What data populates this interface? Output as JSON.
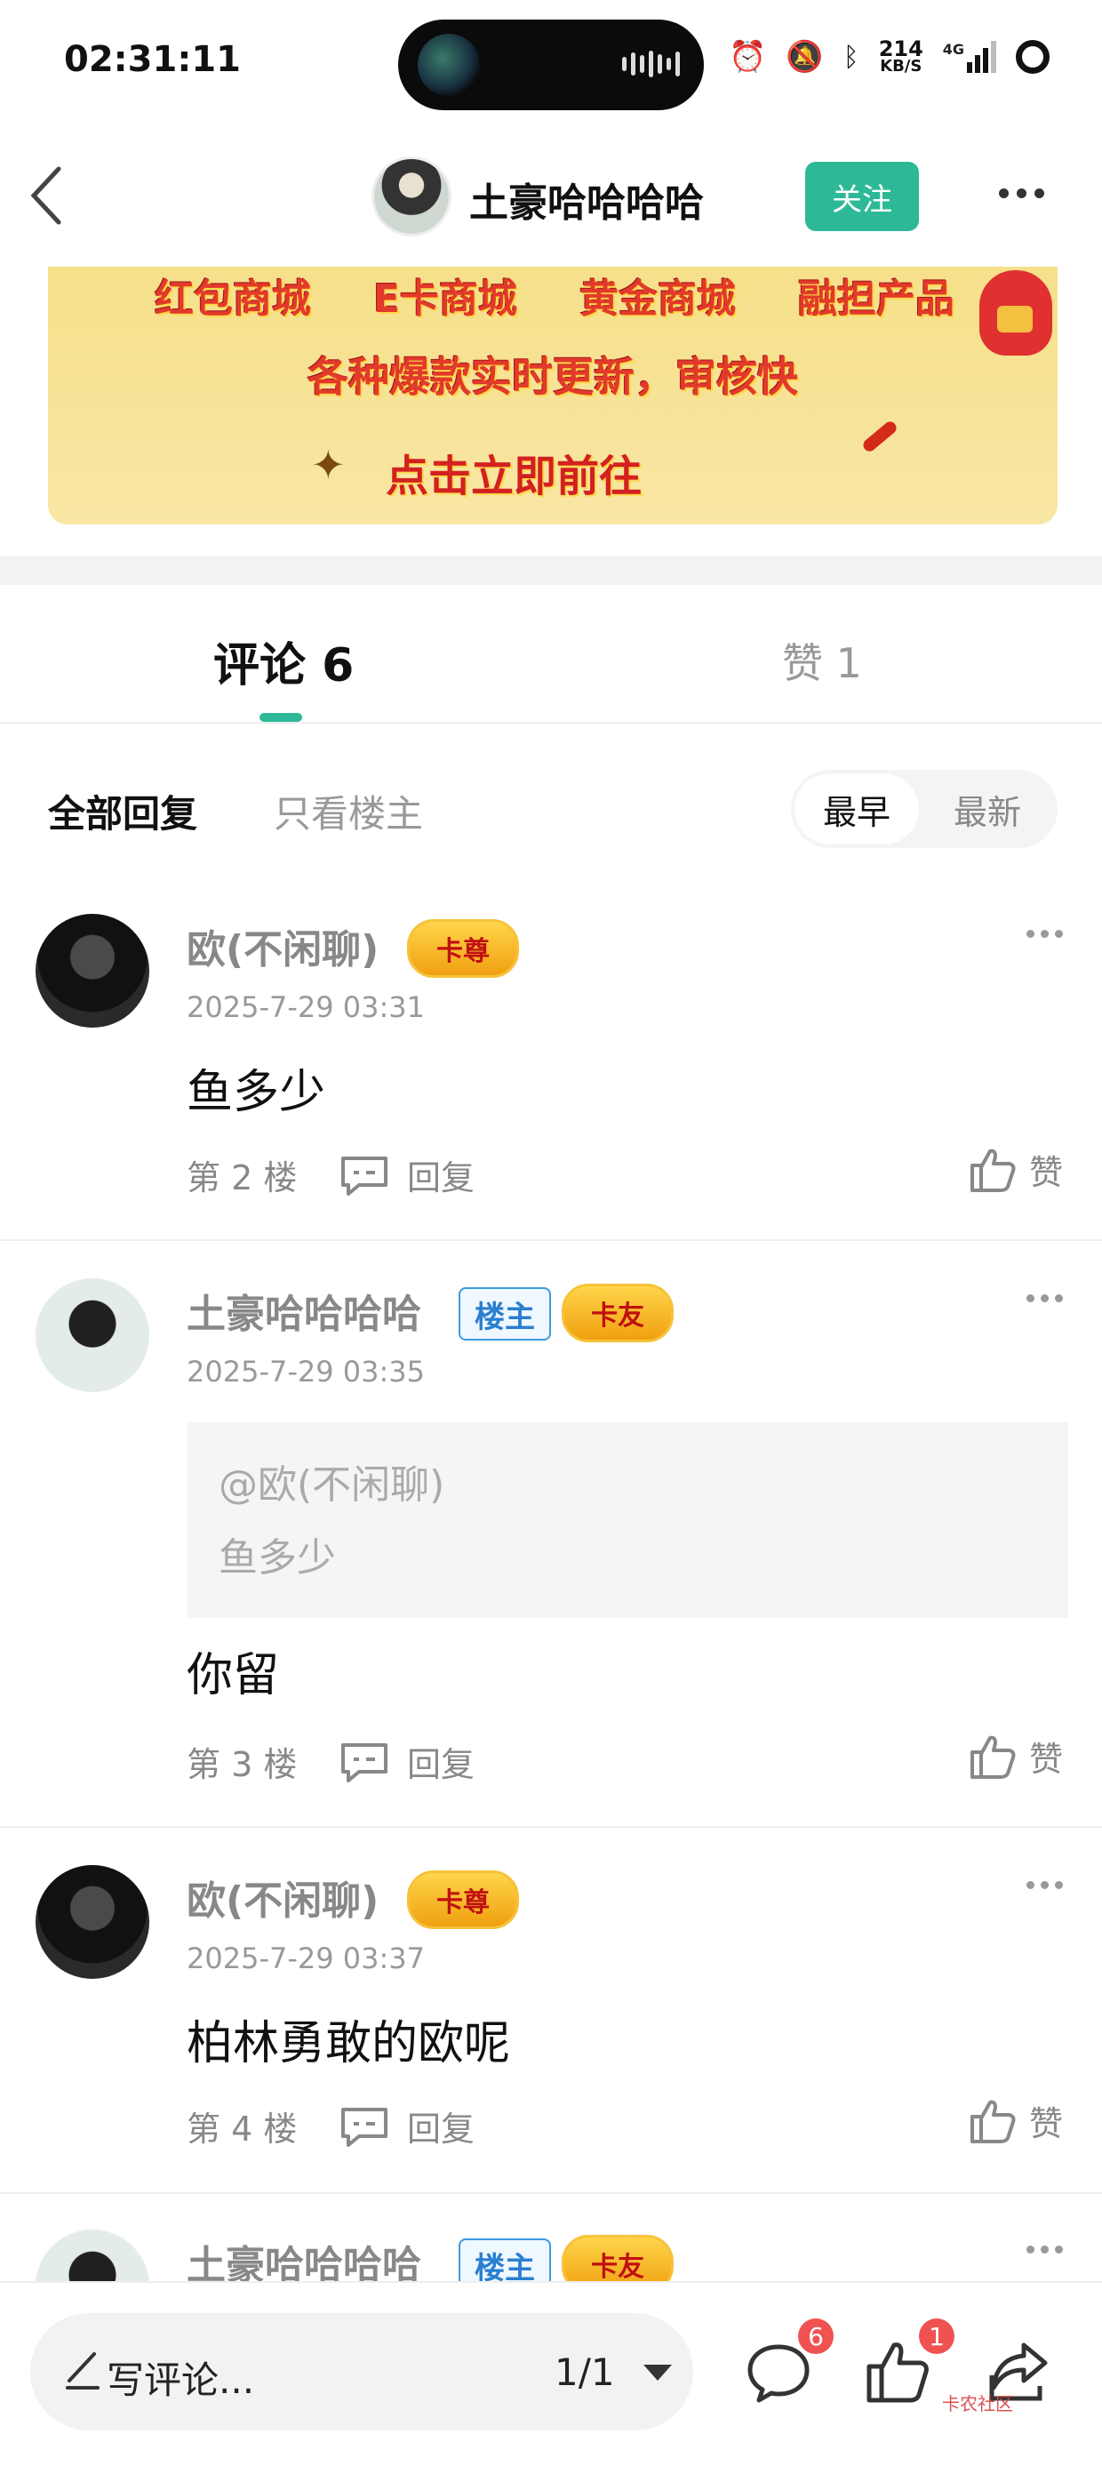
{
  "status_bar": {
    "time": "02:31:11",
    "net_speed": "214",
    "net_unit": "KB/S",
    "network": "4G"
  },
  "header": {
    "title": "土豪哈哈哈哈",
    "follow_label": "关注"
  },
  "banner": {
    "items": [
      "红包商城",
      "E卡商城",
      "黄金商城",
      "融担产品"
    ],
    "line2": "各种爆款实时更新，审核快",
    "cta": "点击立即前往"
  },
  "tabs": {
    "comments_label": "评论 6",
    "likes_label": "赞 1"
  },
  "filter": {
    "all_label": "全部回复",
    "op_only_label": "只看楼主",
    "sort_earliest": "最早",
    "sort_latest": "最新"
  },
  "comments": [
    {
      "name": "欧(不闲聊)",
      "badge": "卡尊",
      "time": "2025-7-29 03:31",
      "text": "鱼多少",
      "floor": "第 2 楼",
      "reply_label": "回复",
      "like_label": "赞"
    },
    {
      "name": "土豪哈哈哈哈",
      "host_badge": "楼主",
      "badge": "卡友",
      "time": "2025-7-29 03:35",
      "quote_at": "@欧(不闲聊)",
      "quote_text": "鱼多少",
      "text": "你留",
      "floor": "第 3 楼",
      "reply_label": "回复",
      "like_label": "赞"
    },
    {
      "name": "欧(不闲聊)",
      "badge": "卡尊",
      "time": "2025-7-29 03:37",
      "text": "柏林勇敢的欧呢",
      "floor": "第 4 楼",
      "reply_label": "回复",
      "like_label": "赞"
    },
    {
      "name": "土豪哈哈哈哈",
      "host_badge": "楼主",
      "badge": "卡友"
    }
  ],
  "bottom_bar": {
    "write_placeholder": "写评论...",
    "page_indicator": "1/1",
    "comment_count": "6",
    "like_count": "1",
    "watermark": "卡农社区"
  },
  "colors": {
    "accent": "#2db997",
    "badge_red": "#f05252",
    "host_blue": "#2a7fd0"
  }
}
